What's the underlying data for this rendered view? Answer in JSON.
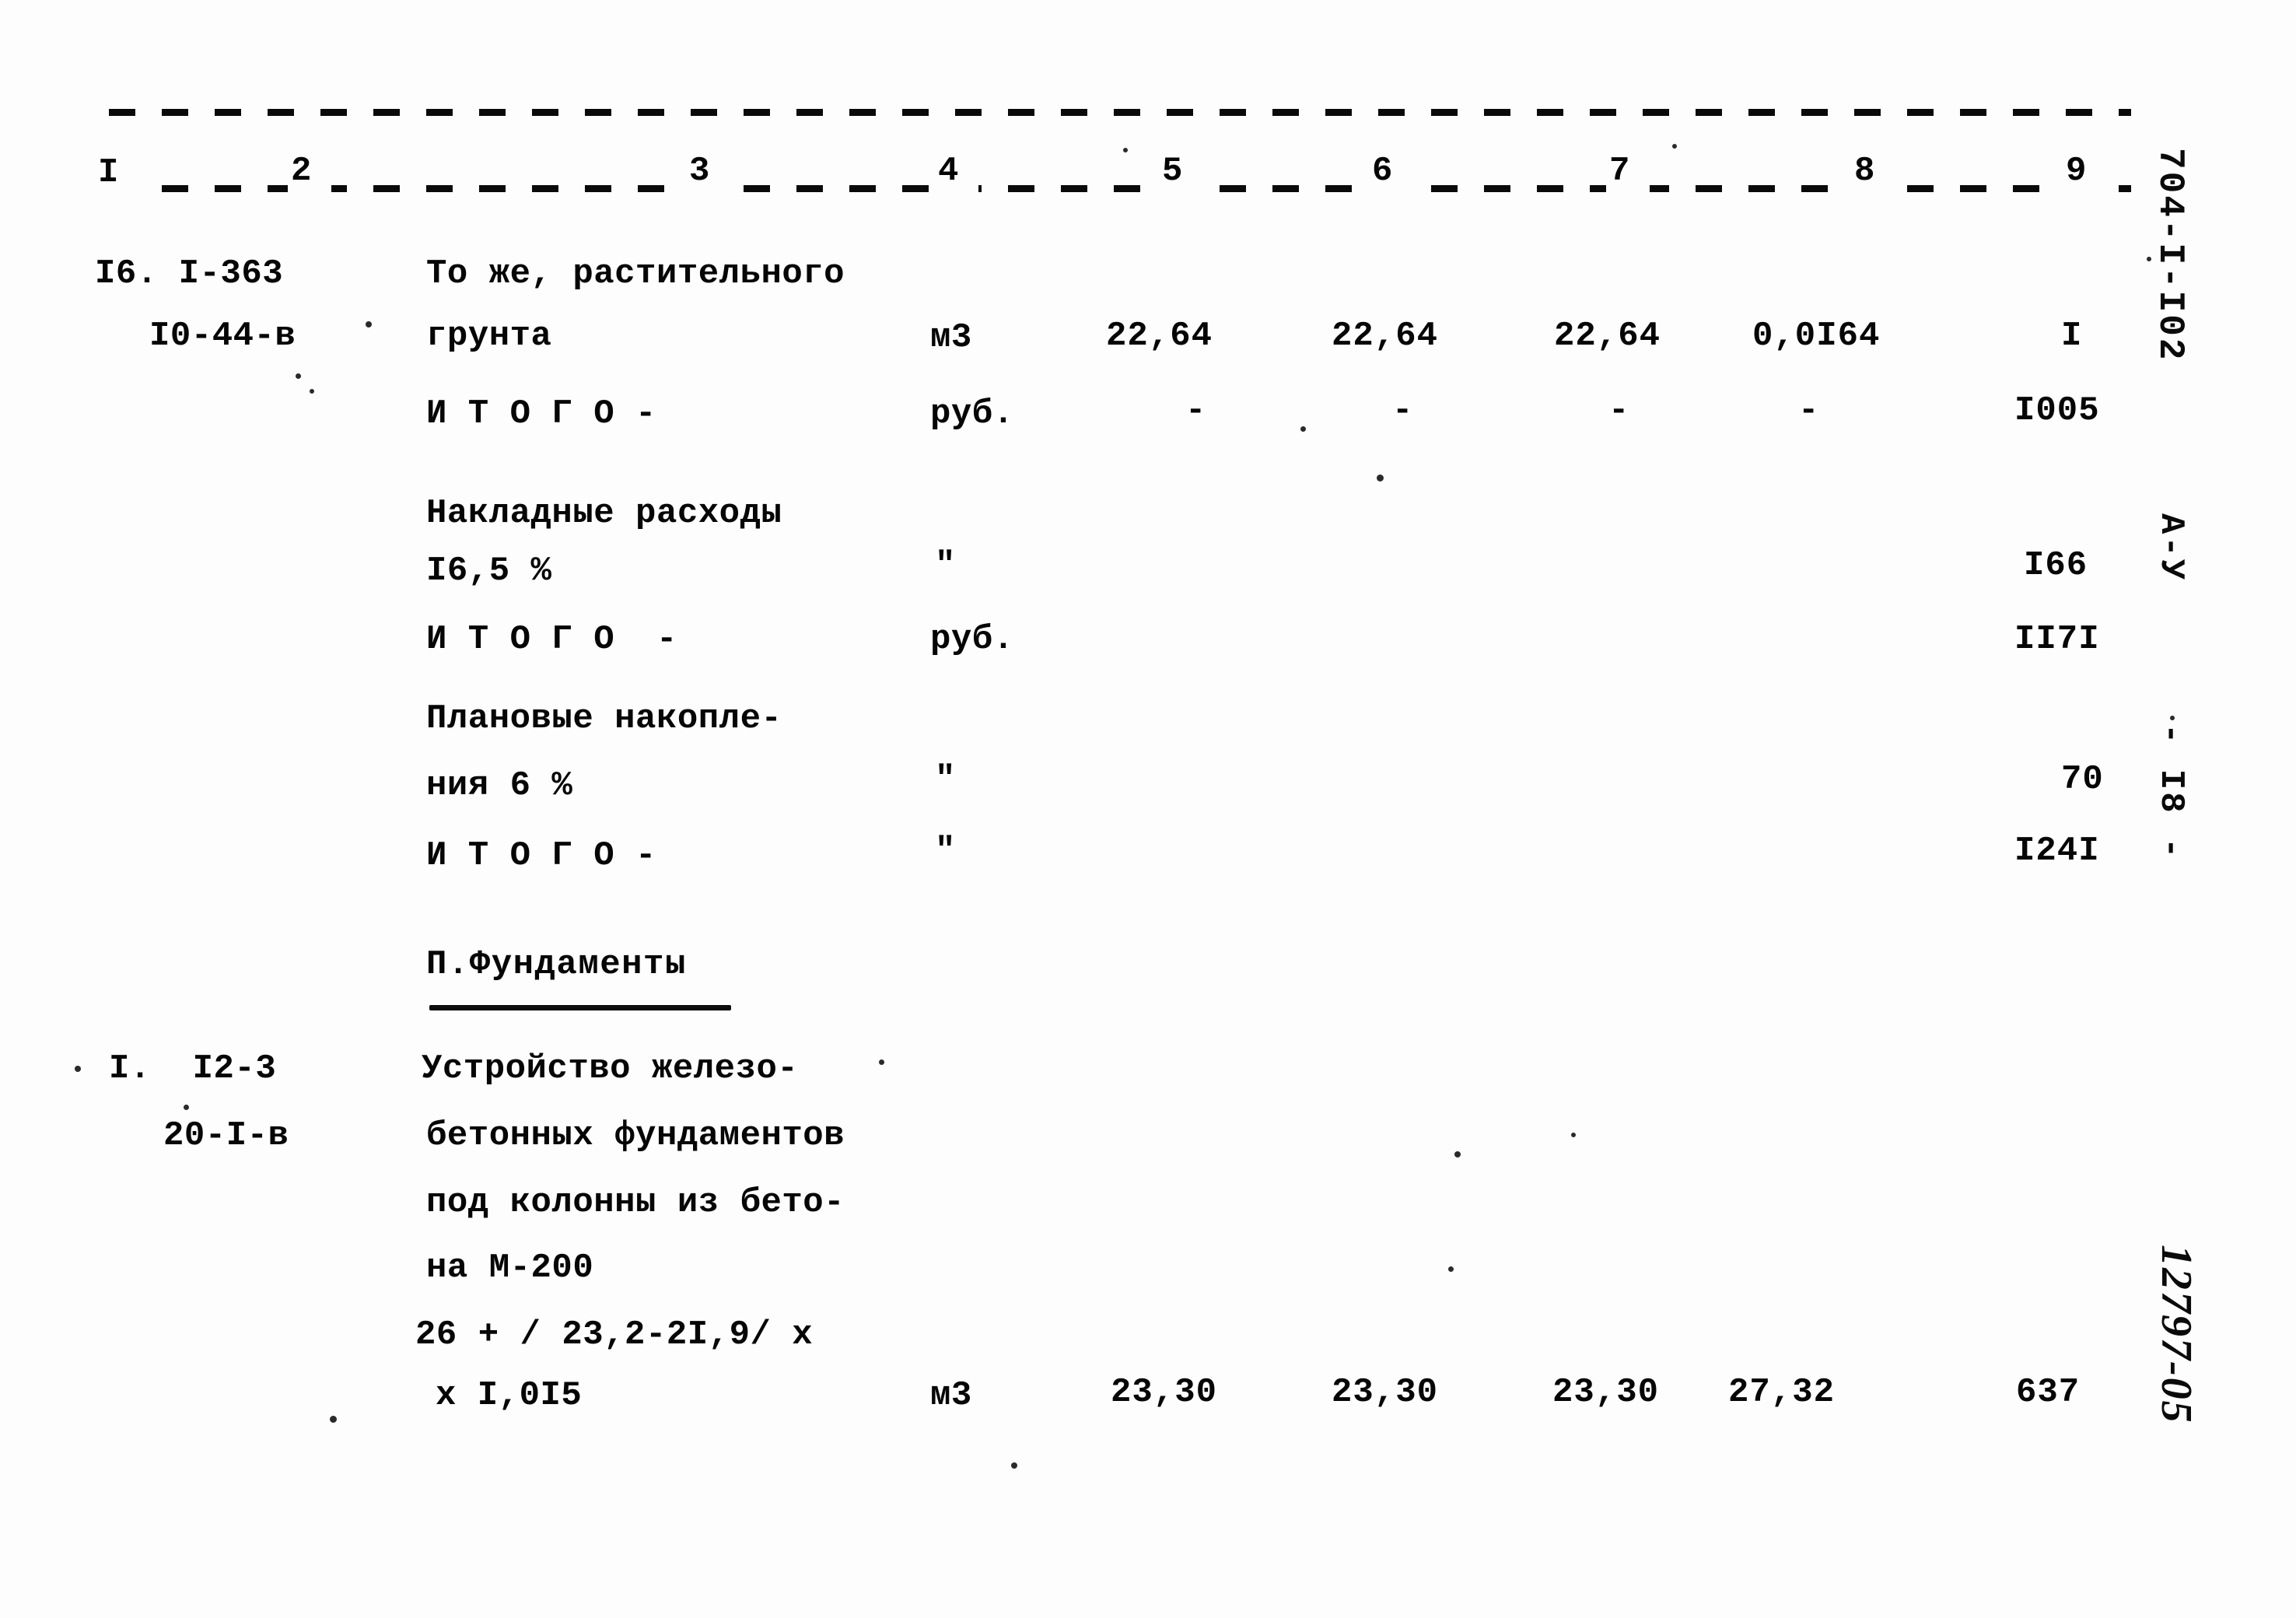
{
  "document": {
    "type": "construction-cost-estimate",
    "language": "ru",
    "right_margin_code": "704-I-I02",
    "right_margin_series": "А-У",
    "page_marker": "- I8 -",
    "handwritten_archive_number": "12797-05"
  },
  "table": {
    "column_numbers": [
      "I",
      "2",
      "3",
      "4",
      "5",
      "6",
      "7",
      "8",
      "9"
    ],
    "rows": [
      {
        "id": "row-1",
        "col1_line1": "I6. I-363",
        "col1_line2": "I0-44-в",
        "col3_line1": "То же, растительного",
        "col3_line2": "грунта",
        "col4": "м3",
        "col5": "22,64",
        "col6": "22,64",
        "col7": "22,64",
        "col8": "0,0I64",
        "col9": "I"
      },
      {
        "id": "row-2-itogo",
        "col3": "И Т О Г О -",
        "col4": "руб.",
        "col5": "-",
        "col6": "-",
        "col7": "-",
        "col8": "-",
        "col9": "I005"
      },
      {
        "id": "row-3-overhead",
        "col3_line1": "Накладные расходы",
        "col3_line2": "I6,5 %",
        "col4": "\"",
        "col9": "I66"
      },
      {
        "id": "row-4-itogo",
        "col3": "И Т О Г О  -",
        "col4": "руб.",
        "col9": "II7I"
      },
      {
        "id": "row-5-planned-savings",
        "col3_line1": "Плановые накопле-",
        "col3_line2": "ния 6 %",
        "col4": "\"",
        "col9": "70"
      },
      {
        "id": "row-6-itogo",
        "col3": "И Т О Г О -",
        "col4": "\"",
        "col9": "I24I"
      },
      {
        "id": "row-7-section-heading",
        "col3": "П.Фундаменты"
      },
      {
        "id": "row-8",
        "col1_line1": "I.  I2-3",
        "col1_line2": "20-I-в",
        "col3_line1": "Устройство железо-",
        "col3_line2": "бетонных фундаментов",
        "col3_line3": "под колонны из бето-",
        "col3_line4": "на М-200",
        "col3_line5": "26 + / 23,2-2I,9/ х",
        "col3_line6": "х I,0I5",
        "col4": "м3",
        "col5": "23,30",
        "col6": "23,30",
        "col7": "23,30",
        "col8": "27,32",
        "col9": "637"
      }
    ]
  }
}
